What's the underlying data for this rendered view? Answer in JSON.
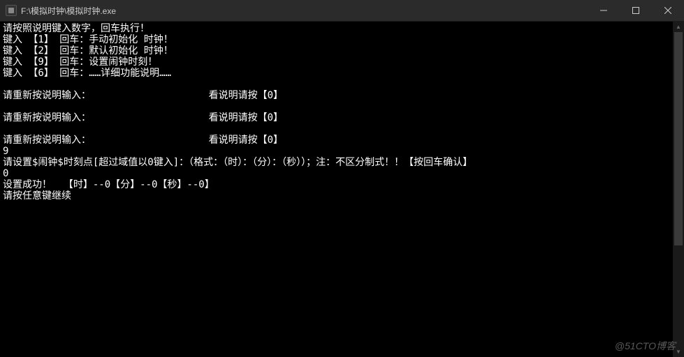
{
  "titlebar": {
    "path": "F:\\模拟时钟\\模拟时钟.exe"
  },
  "console": {
    "lines": [
      "请按照说明键入数字，回车执行！",
      "键入 【1】 回车：手动初始化 时钟！",
      "键入 【2】 回车：默认初始化 时钟！",
      "键入 【9】 回车：设置闹钟时刻！",
      "键入 【6】 回车：……详细功能说明……",
      "",
      "请重新按说明输入：                    看说明请按【0】",
      "",
      "请重新按说明输入：                    看说明请按【0】",
      "",
      "请重新按说明输入：                    看说明请按【0】",
      "9",
      "请设置$闹钟$时刻点[超过域值以0键入]：（格式：（时）：（分）：（秒））；注：不区分制式！！【按回车确认】",
      "0",
      "设置成功！  【时】--0【分】--0【秒】--0】",
      "请按任意键继续"
    ]
  },
  "watermark": "@51CTO博客"
}
